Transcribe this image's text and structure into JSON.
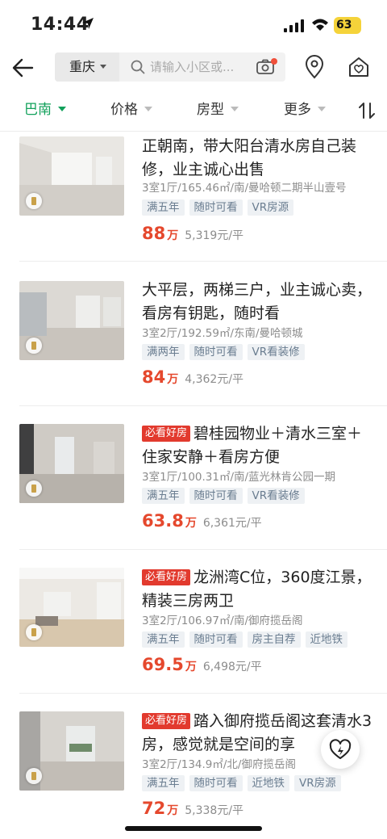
{
  "status": {
    "time": "14:44",
    "battery": "63"
  },
  "search": {
    "city": "重庆",
    "placeholder": "请输入小区或..."
  },
  "filters": {
    "area": "巴南",
    "price": "价格",
    "layout": "房型",
    "more": "更多"
  },
  "listings": [
    {
      "title": "正朝南，带大阳台清水房自己装修，业主诚心出售",
      "badge": "",
      "meta": "3室1厅/165.46㎡/南/曼哈顿二期半山壹号",
      "tags": [
        "满五年",
        "随时可看",
        "VR房源"
      ],
      "price": "88",
      "unit": "万",
      "per": "5,319元/平"
    },
    {
      "title": "大平层，两梯三户，业主诚心卖，看房有钥匙，随时看",
      "badge": "",
      "meta": "3室2厅/192.59㎡/东南/曼哈顿城",
      "tags": [
        "满两年",
        "随时可看",
        "VR看装修"
      ],
      "price": "84",
      "unit": "万",
      "per": "4,362元/平"
    },
    {
      "title": "碧桂园物业＋清水三室＋住家安静＋看房方便",
      "badge": "必看好房",
      "meta": "3室1厅/100.31㎡/南/蓝光林肯公园一期",
      "tags": [
        "满五年",
        "随时可看",
        "VR看装修"
      ],
      "price": "63.8",
      "unit": "万",
      "per": "6,361元/平"
    },
    {
      "title": "龙洲湾C位，360度江景，精装三房两卫",
      "badge": "必看好房",
      "meta": "3室2厅/106.97㎡/南/御府揽岳阁",
      "tags": [
        "满五年",
        "随时可看",
        "房主自荐",
        "近地铁"
      ],
      "price": "69.5",
      "unit": "万",
      "per": "6,498元/平"
    },
    {
      "title": "踏入御府揽岳阁这套清水3房，感觉就是空间的享",
      "badge": "必看好房",
      "meta": "3室2厅/134.9㎡/北/御府揽岳阁",
      "tags": [
        "满五年",
        "随时可看",
        "近地铁",
        "VR房源"
      ],
      "price": "72",
      "unit": "万",
      "per": "5,338元/平"
    }
  ]
}
